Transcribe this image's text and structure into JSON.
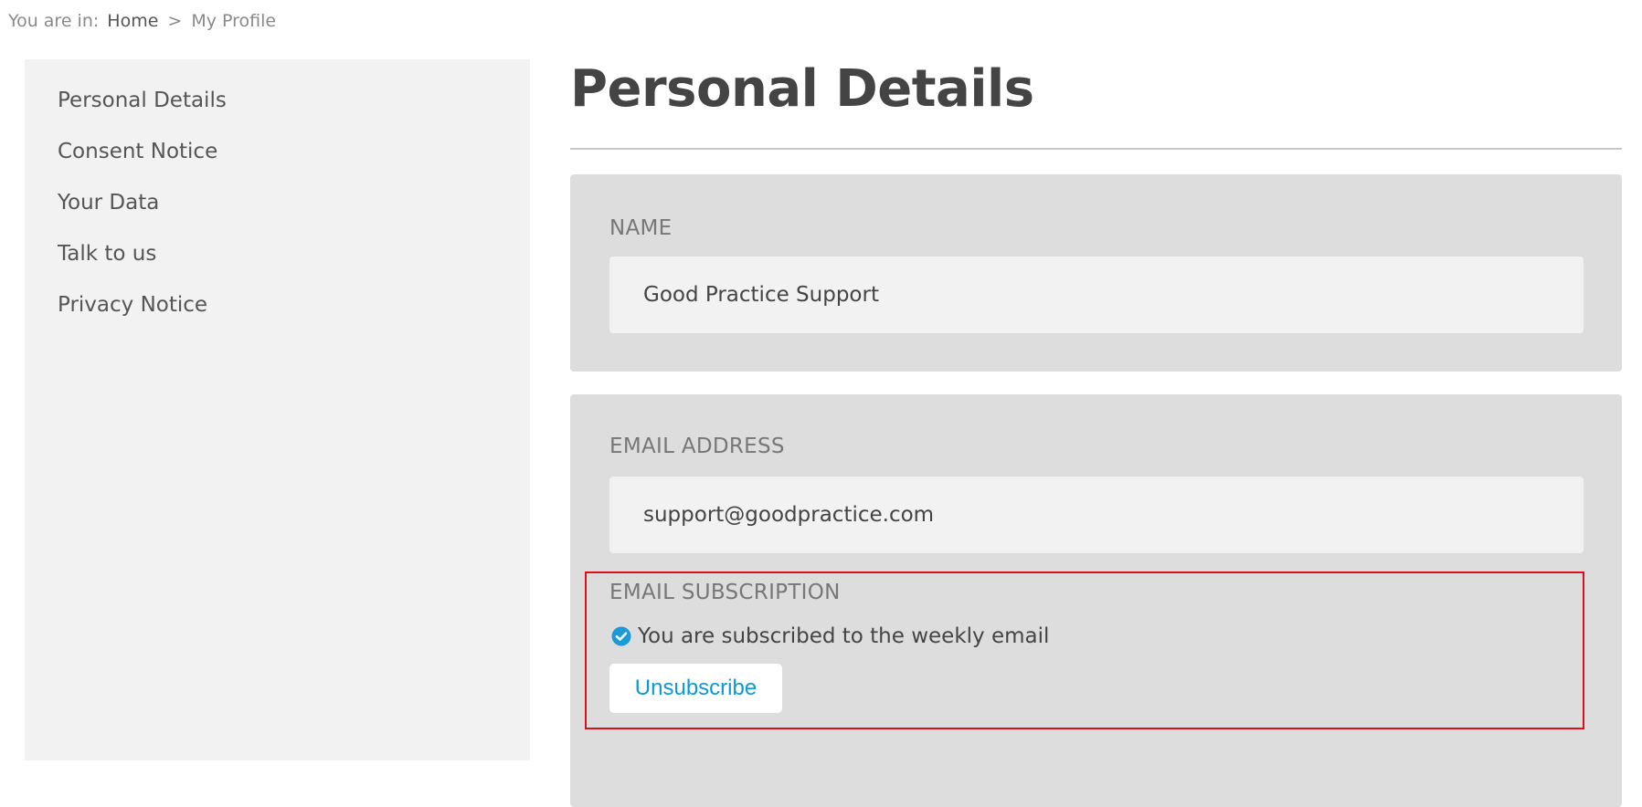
{
  "breadcrumb": {
    "prefix": "You are in:",
    "home": "Home",
    "separator": ">",
    "current": "My Profile"
  },
  "sidebar": {
    "items": [
      {
        "label": "Personal Details"
      },
      {
        "label": "Consent Notice"
      },
      {
        "label": "Your Data"
      },
      {
        "label": "Talk to us"
      },
      {
        "label": "Privacy Notice"
      }
    ]
  },
  "main": {
    "title": "Personal Details",
    "name": {
      "label": "NAME",
      "value": "Good Practice Support"
    },
    "email": {
      "label": "EMAIL ADDRESS",
      "value": "support@goodpractice.com"
    },
    "subscription": {
      "label": "EMAIL SUBSCRIPTION",
      "status": "You are subscribed to the weekly email",
      "status_icon": "check-circle-icon",
      "button_label": "Unsubscribe"
    }
  },
  "colors": {
    "highlight_border": "#d9111e",
    "link_blue": "#0a9ad6",
    "card_bg": "#dddddd",
    "sidebar_bg": "#f2f2f2"
  }
}
